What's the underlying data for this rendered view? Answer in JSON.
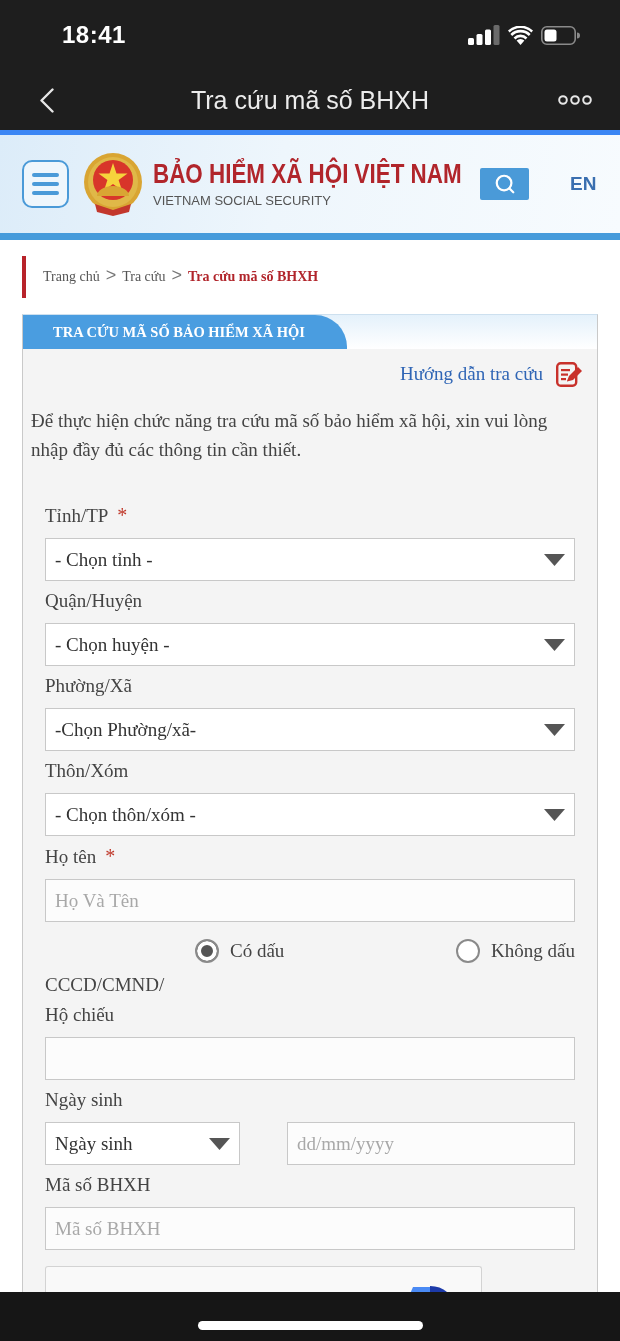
{
  "status_bar": {
    "time": "18:41"
  },
  "nav_bar": {
    "title": "Tra cứu mã số BHXH"
  },
  "site_header": {
    "title": "BẢO HIỂM XÃ HỘI VIỆT NAM",
    "subtitle": "VIETNAM SOCIAL SECURITY",
    "language": "EN"
  },
  "breadcrumb": [
    {
      "label": "Trang chủ",
      "current": false
    },
    {
      "separator": ">",
      "label": "Tra cứu",
      "current": false
    },
    {
      "separator": ">",
      "label": "Tra cứu mã số BHXH",
      "current": true
    }
  ],
  "panel": {
    "tab": "TRA CỨU MÃ SỐ BẢO HIỂM XÃ HỘI",
    "help_link": "Hướng dẫn tra cứu",
    "intro": "Để thực hiện chức năng tra cứu mã số bảo hiểm xã hội, xin vui lòng nhập đầy đủ các thông tin cần thiết.",
    "fields": [
      {
        "kind": "select",
        "label": "Tỉnh/TP",
        "required_mark": "*",
        "value": "- Chọn tỉnh -"
      },
      {
        "kind": "select",
        "label": "Quận/Huyện",
        "value": "- Chọn huyện -"
      },
      {
        "kind": "select",
        "label": "Phường/Xã",
        "value": "-Chọn Phường/xã-"
      },
      {
        "kind": "select",
        "label": "Thôn/Xóm",
        "value": "- Chọn thôn/xóm -"
      },
      {
        "kind": "input",
        "label": "Họ tên",
        "required_mark": "*",
        "placeholder": "Họ Và Tên"
      },
      {
        "kind": "radio_group",
        "options": [
          {
            "label": "Có dấu",
            "selected": true
          },
          {
            "label": "Không dấu",
            "selected": false
          }
        ]
      },
      {
        "kind": "input",
        "label_lines": [
          "CCCD/CMND/",
          "Hộ chiếu"
        ]
      },
      {
        "kind": "date_row",
        "label": "Ngày sinh",
        "select_value": "Ngày sinh",
        "placeholder": "dd/mm/yyyy"
      },
      {
        "kind": "input",
        "label": "Mã số BHXH",
        "placeholder": "Mã số BHXH"
      }
    ]
  }
}
